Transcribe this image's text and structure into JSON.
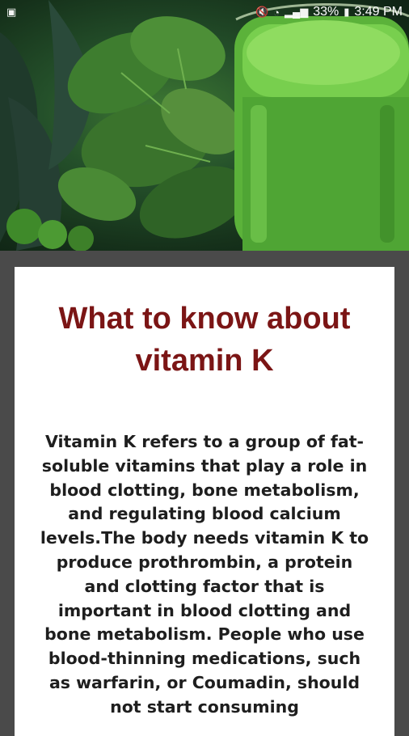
{
  "status_bar": {
    "battery": "33%",
    "time": "3:49 PM"
  },
  "hero_image": {
    "description_icon": "vegetables-juice-image"
  },
  "article": {
    "title": "What to know about vitamin K",
    "body": "Vitamin K refers to a group of fat-soluble vitamins that play a role in blood clotting, bone metabolism, and regulating blood calcium levels.The body needs vitamin K to produce prothrombin, a protein and clotting factor that is important in blood clotting and bone metabolism. People who use blood-thinning medications, such as warfarin, or Coumadin, should not start consuming"
  },
  "colors": {
    "title": "#7b1515",
    "body_text": "#1e1e1e",
    "background": "#4a4a4a",
    "card": "#ffffff"
  }
}
